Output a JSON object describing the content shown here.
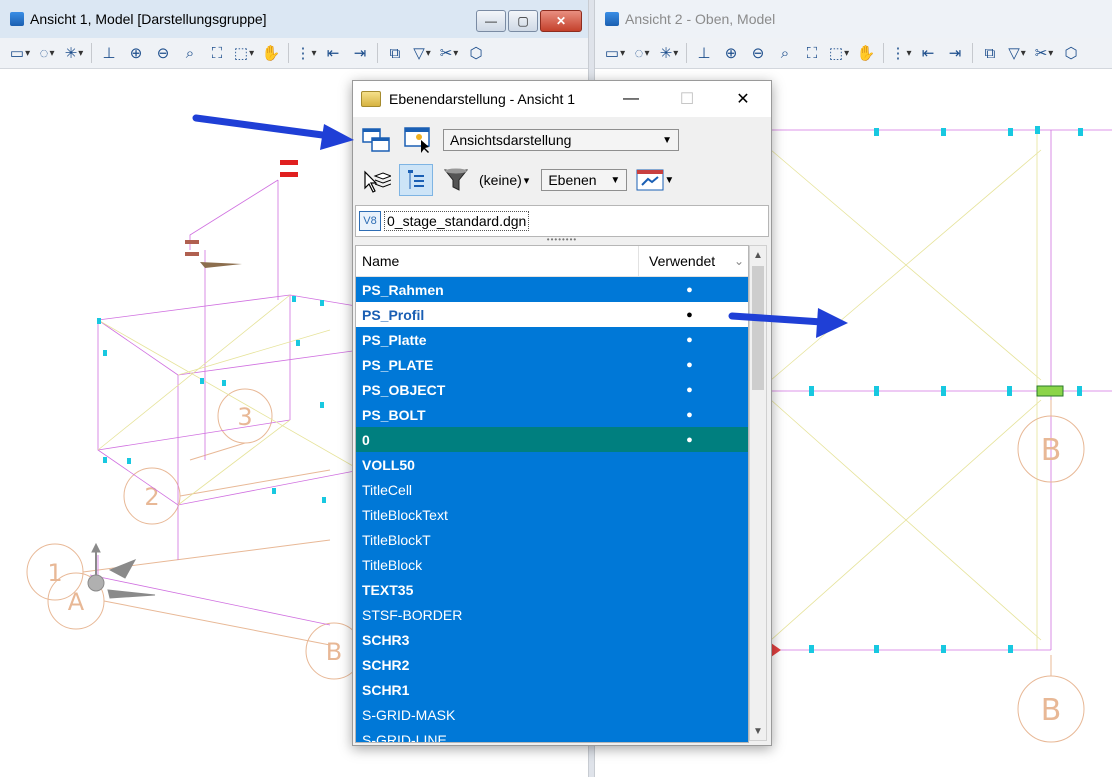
{
  "view1": {
    "title": "Ansicht 1, Model [Darstellungsgruppe]",
    "caption_buttons": [
      "—",
      "▢",
      "✕"
    ],
    "grid_labels": [
      "1",
      "2",
      "3",
      "A",
      "B"
    ]
  },
  "view2": {
    "title": "Ansicht 2 - Oben, Model",
    "grid_labels": [
      "B",
      "B"
    ]
  },
  "toolbar_icons": [
    "view-attributes-icon",
    "display-style-icon",
    "light-icon",
    "brush-icon",
    "zoom-in-icon",
    "zoom-out-icon",
    "window-area-icon",
    "fit-view-icon",
    "rotate-view-icon",
    "pan-view-icon",
    "walk-icon",
    "previous-view-icon",
    "next-view-icon",
    "clip-volume-icon",
    "clip-mask-icon",
    "named-boundary-icon"
  ],
  "dialog": {
    "title": "Ebenendarstellung - Ansicht 1",
    "caption_buttons": [
      "—",
      "☐",
      "✕"
    ],
    "display_mode": "Ansichtsdarstellung",
    "filter_label": "(keine)",
    "filter_arrow": "▾",
    "levels_combo": "Ebenen",
    "file_badge": "V8",
    "file_name": "0_stage_standard.dgn",
    "grip": "••••••••",
    "columns": {
      "name": "Name",
      "used": "Verwendet",
      "sort": "⌄"
    },
    "scroll": {
      "up": "▲",
      "down": "▼"
    },
    "levels": [
      {
        "name": "PS_Rahmen",
        "used": "●",
        "bold": true,
        "state": "selected"
      },
      {
        "name": "PS_Profil",
        "used": "●",
        "bold": true,
        "state": "off"
      },
      {
        "name": "PS_Platte",
        "used": "●",
        "bold": true,
        "state": "selected"
      },
      {
        "name": "PS_PLATE",
        "used": "●",
        "bold": true,
        "state": "selected"
      },
      {
        "name": "PS_OBJECT",
        "used": "●",
        "bold": true,
        "state": "selected"
      },
      {
        "name": "PS_BOLT",
        "used": "●",
        "bold": true,
        "state": "selected"
      },
      {
        "name": "0",
        "used": "●",
        "bold": true,
        "state": "active"
      },
      {
        "name": "VOLL50",
        "used": "",
        "bold": true,
        "state": "selected"
      },
      {
        "name": "TitleCell",
        "used": "",
        "bold": false,
        "state": "selected"
      },
      {
        "name": "TitleBlockText",
        "used": "",
        "bold": false,
        "state": "selected"
      },
      {
        "name": "TitleBlockT",
        "used": "",
        "bold": false,
        "state": "selected"
      },
      {
        "name": "TitleBlock",
        "used": "",
        "bold": false,
        "state": "selected"
      },
      {
        "name": "TEXT35",
        "used": "",
        "bold": true,
        "state": "selected"
      },
      {
        "name": "STSF-BORDER",
        "used": "",
        "bold": false,
        "state": "selected"
      },
      {
        "name": "SCHR3",
        "used": "",
        "bold": true,
        "state": "selected"
      },
      {
        "name": "SCHR2",
        "used": "",
        "bold": true,
        "state": "selected"
      },
      {
        "name": "SCHR1",
        "used": "",
        "bold": true,
        "state": "selected"
      },
      {
        "name": "S-GRID-MASK",
        "used": "",
        "bold": false,
        "state": "selected"
      },
      {
        "name": "S-GRID-LINE",
        "used": "",
        "bold": false,
        "state": "selected"
      }
    ]
  },
  "colors": {
    "selection": "#0078d7",
    "active_row": "#007f7f",
    "annotation_arrow": "#1f3fd6",
    "grid_line": "#e8c8a8",
    "element_magenta": "#d070e0",
    "element_cyan": "#18c8e0"
  }
}
